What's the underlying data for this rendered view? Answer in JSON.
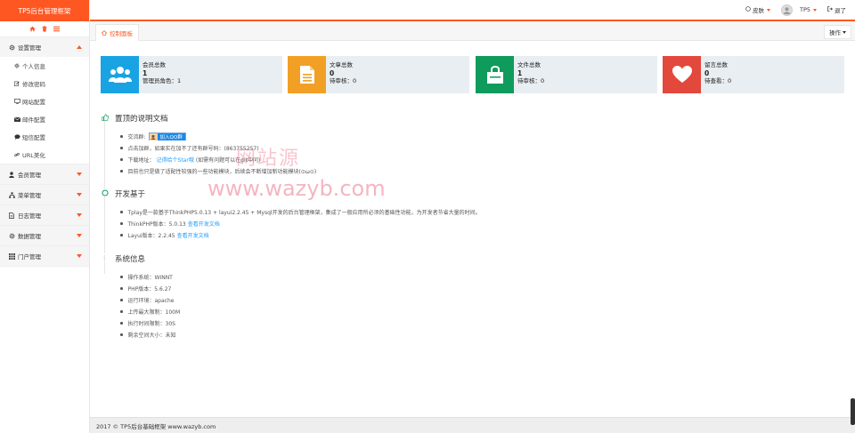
{
  "app": {
    "title": "TP5后台管理框架"
  },
  "topbar": {
    "skin_label": "皮肤",
    "user_name": "TP5",
    "logout_label": "退了"
  },
  "tabs": {
    "active": "控制面板",
    "ops_label": "操作"
  },
  "colors": {
    "accent": "#ff5722",
    "card_blue": "#1aa3e3",
    "card_orange": "#f1a025",
    "card_green": "#0f9b5c",
    "card_red": "#e3483c",
    "link": "#1e9fff"
  },
  "sidebar": {
    "groups": [
      {
        "label": "设置管理",
        "icon": "gear-icon",
        "expanded": true,
        "items": [
          {
            "label": "个人信息",
            "icon": "gear-icon"
          },
          {
            "label": "修改密码",
            "icon": "edit-icon"
          },
          {
            "label": "网站配置",
            "icon": "monitor-icon"
          },
          {
            "label": "邮件配置",
            "icon": "envelope-icon"
          },
          {
            "label": "短信配置",
            "icon": "comment-icon"
          },
          {
            "label": "URL美化",
            "icon": "link-icon"
          }
        ]
      },
      {
        "label": "会员管理",
        "icon": "user-icon"
      },
      {
        "label": "菜单管理",
        "icon": "sitemap-icon"
      },
      {
        "label": "日志管理",
        "icon": "file-icon"
      },
      {
        "label": "数据管理",
        "icon": "database-icon"
      },
      {
        "label": "门户管理",
        "icon": "grid-icon"
      }
    ]
  },
  "cards": [
    {
      "title": "会员总数",
      "value": "1",
      "sub": "管理员角色：1",
      "icon": "users-icon"
    },
    {
      "title": "文章总数",
      "value": "0",
      "sub": "待审核：0",
      "icon": "document-icon"
    },
    {
      "title": "文件总数",
      "value": "1",
      "sub": "待审核：0",
      "icon": "bag-icon"
    },
    {
      "title": "留言总数",
      "value": "0",
      "sub": "待查看：0",
      "icon": "heart-icon"
    }
  ],
  "sections": {
    "notice": {
      "title": "置顶的说明文档",
      "qq_label": "交流群:",
      "qq_badge": "加入QQ群",
      "line2": "点击加群，如果实在加不了还有群号码：(863755257)",
      "download_label": "下载地址：",
      "download_link": "记得给个Star哦",
      "download_tail": "(如需有问题可以在git中问)",
      "line4": "目前也只是做了适配性较强的一些功能模块，后续会不断增加新功能模块(⊙ω⊙)"
    },
    "dev": {
      "title": "开发基于",
      "line1": "Tplay是一款基于ThinkPHP5.0.13 + layui2.2.45 + Mysql开发的后台管理框架，集成了一般应用所必须的基础性功能，为开发者节省大量的时间。",
      "tp_label": "ThinkPHP版本：5.0.13",
      "tp_link": "查看开发文档",
      "layui_label": "Layui版本：2.2.45",
      "layui_link": "查看开发文档"
    },
    "system": {
      "title": "系统信息",
      "items": [
        "操作系统：WINNT",
        "PHP版本：5.6.27",
        "运行环境：apache",
        "上传最大限制：100M",
        "执行时间限制：30S",
        "剩余空间大小：未知"
      ]
    }
  },
  "watermark": {
    "cn": "网站源",
    "url": "www.wazyb.com"
  },
  "footer": {
    "text": "2017 © TP5后台基础框架 www.wazyb.com"
  }
}
